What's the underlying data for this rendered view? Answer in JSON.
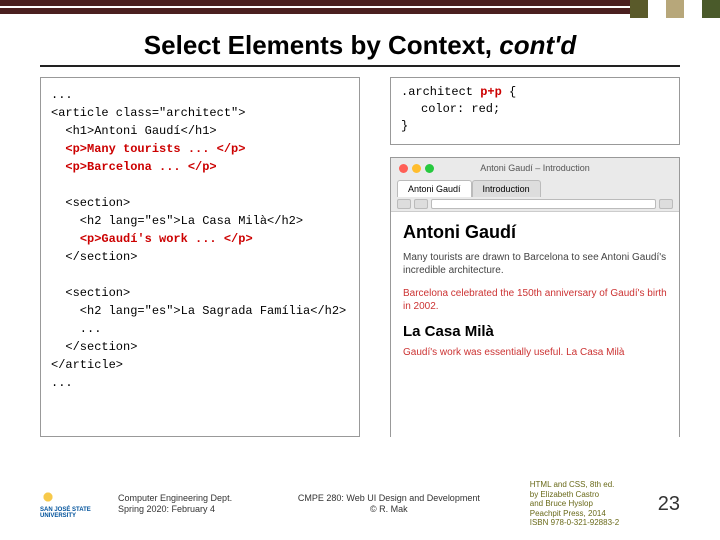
{
  "title": {
    "main": "Select Elements by Context, ",
    "italic": "cont'd"
  },
  "code": {
    "l1": "...",
    "l2": "<article class=\"architect\">",
    "l3": "  <h1>Antoni Gaudí</h1>",
    "l4a": "  ",
    "l4b": "<p>Many tourists ... </p>",
    "l5a": "  ",
    "l5b": "<p>Barcelona ... </p>",
    "l6": "",
    "l7": "  <section>",
    "l8": "    <h2 lang=\"es\">La Casa Milà</h2>",
    "l9a": "    ",
    "l9b": "<p>Gaudí's work ... </p>",
    "l10": "  </section>",
    "l11": "",
    "l12": "  <section>",
    "l13": "    <h2 lang=\"es\">La Sagrada Família</h2>",
    "l14": "    ...",
    "l15": "  </section>",
    "l16": "</article>",
    "l17": "..."
  },
  "css": {
    "selA": ".architect ",
    "selB": "p+p",
    "brace": " {",
    "prop": "color: red;",
    "close": "}"
  },
  "browser": {
    "window_title": "Antoni Gaudí – Introduction",
    "tabs": {
      "active": "Antoni Gaudí",
      "inactive": "Introduction"
    },
    "page": {
      "h1": "Antoni Gaudí",
      "p1": "Many tourists are drawn to Barcelona to see Antoni Gaudí's incredible architecture.",
      "p2": "Barcelona celebrated the 150th anniversary of Gaudí's birth in 2002.",
      "h2": "La Casa Milà",
      "p3": "Gaudí's work was essentially useful. La Casa Milà"
    }
  },
  "footer": {
    "logo": {
      "l1": "SAN JOSÉ STATE",
      "l2": "UNIVERSITY"
    },
    "left": {
      "l1": "Computer Engineering Dept.",
      "l2": "Spring 2020: February 4"
    },
    "center": {
      "l1": "CMPE 280: Web UI Design and Development",
      "l2": "© R. Mak"
    },
    "right": {
      "l1": "HTML and CSS, 8th ed.",
      "l2": "by Elizabeth Castro",
      "l3": "and Bruce Hyslop",
      "l4": "Peachpit Press, 2014",
      "l5": "ISBN 978-0-321-92883-2"
    },
    "page": "23"
  }
}
